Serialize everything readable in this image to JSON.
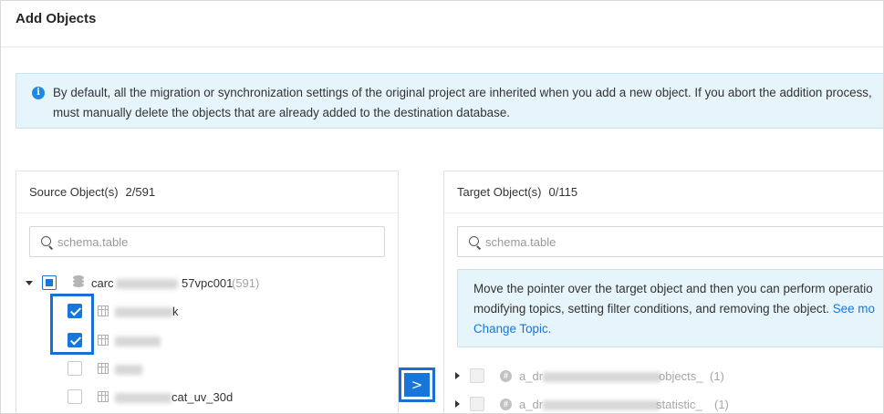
{
  "dialog": {
    "title": "Add Objects"
  },
  "notice": {
    "icon": "info-icon",
    "line1": "By default, all the migration or synchronization settings of the original project are inherited when you add a new object. If you abort the addition process,",
    "line2": "must manually delete the objects that are already added to the destination database."
  },
  "source": {
    "title": "Source Object(s)",
    "count": "2/591",
    "search_placeholder": "schema.table",
    "schema": {
      "name_prefix": "carc",
      "name_suffix": "57vpc001",
      "count": "(591)"
    },
    "tables": [
      {
        "suffix": "k",
        "checked": true
      },
      {
        "suffix": "",
        "checked": true
      },
      {
        "suffix": "",
        "checked": false
      },
      {
        "suffix": "cat_uv_30d",
        "checked": false
      }
    ]
  },
  "transfer": {
    "label": ">"
  },
  "target": {
    "title": "Target Object(s)",
    "count": "0/115",
    "search_placeholder": "schema.table",
    "tip": {
      "line1": "Move the pointer over the target object and then you can perform operatio",
      "line2_text": "modifying topics, setting filter conditions, and removing the object. ",
      "line2_link": "See mo",
      "line3_link": "Change Topic."
    },
    "topics": [
      {
        "prefix": "a_dr",
        "suffix": "objects_",
        "count": "(1)"
      },
      {
        "prefix": "a_dr",
        "suffix": "statistic_",
        "count": "(1)"
      }
    ]
  },
  "colors": {
    "accent": "#1777d8",
    "highlight": "#1a6fd6",
    "notice_bg": "#e6f4fb"
  }
}
